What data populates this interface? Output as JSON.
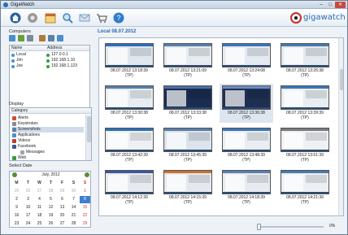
{
  "window": {
    "title": "GigaWatch",
    "min": "–",
    "max": "□",
    "close": "✕"
  },
  "toolbar": {
    "buttons": [
      {
        "icon": "home-icon",
        "color": "#2a5f9e"
      },
      {
        "icon": "gear-icon",
        "color": "#8e8e8e"
      },
      {
        "icon": "calendar-icon",
        "color": "#d8a23a"
      },
      {
        "icon": "search-icon",
        "color": "#3d86c9"
      },
      {
        "icon": "mail-icon",
        "color": "#9ab8d8"
      },
      {
        "icon": "cart-icon",
        "color": "#7a7a7a"
      },
      {
        "icon": "help-icon",
        "color": "#2f7ccc"
      }
    ],
    "logo_text": "gigawatch"
  },
  "sidebar": {
    "computers_label": "Computers",
    "computers_header": {
      "name": "Name",
      "address": "Address"
    },
    "computers": [
      {
        "name": "Local",
        "address": "127.0.0.1"
      },
      {
        "name": "Jim",
        "address": "192.168.1.10"
      },
      {
        "name": "Joe",
        "address": "192.168.1.123"
      }
    ],
    "display_label": "Display",
    "category_header": "Category",
    "categories": [
      {
        "label": "Alerts",
        "color": "#d04a3a",
        "indent": 0
      },
      {
        "label": "Keystrokes",
        "color": "#8a8a8a",
        "indent": 0
      },
      {
        "label": "Screenshots",
        "color": "#5c7fa8",
        "indent": 0
      },
      {
        "label": "Applications",
        "color": "#4a8ed0",
        "indent": 0
      },
      {
        "label": "Videos",
        "color": "#c0392b",
        "indent": 0
      },
      {
        "label": "Facebook",
        "color": "#3b5998",
        "indent": 0
      },
      {
        "label": "Messages",
        "color": "#9aa6b2",
        "indent": 1
      },
      {
        "label": "Web",
        "color": "#3a9a3a",
        "indent": 0
      }
    ],
    "select_date_label": "Select Date",
    "calendar": {
      "month_label": "July,   2012",
      "weekdays": [
        "M",
        "T",
        "W",
        "T",
        "F",
        "S",
        "S"
      ],
      "weeks": [
        [
          "25",
          "26",
          "27",
          "28",
          "29",
          "30",
          "1"
        ],
        [
          "2",
          "3",
          "4",
          "5",
          "6",
          "7",
          "8"
        ],
        [
          "9",
          "10",
          "11",
          "12",
          "13",
          "14",
          "15"
        ],
        [
          "16",
          "17",
          "18",
          "19",
          "20",
          "21",
          "22"
        ],
        [
          "23",
          "24",
          "25",
          "26",
          "27",
          "28",
          "29"
        ]
      ],
      "selected": "8"
    }
  },
  "main": {
    "title": "Local 08.07.2012",
    "captions": [
      "08.07.2012 13:18:39\n(TP)",
      "08.07.2012 13:21:09\n(TP)",
      "08.07.2012 13:24:08\n(TP)",
      "08.07.2012 13:26:38\n(TP)",
      "08.07.2012 13:30:38\n(TP)",
      "08.07.2012 13:33:38\n(TP)",
      "08.07.2012 13:36:38\n(TP)",
      "08.07.2012 13:39:39\n(TP)",
      "08.07.2012 13:42:39\n(TP)",
      "08.07.2012 13:45:39\n(TP)",
      "08.07.2012 13:48:39\n(TP)",
      "08.07.2012 13:51:39\n(TP)",
      "08.07.2012 14:12:39\n(TP)",
      "08.07.2012 14:15:39\n(TP)",
      "08.07.2012 14:18:39\n(TP)",
      "08.07.2012 14:21:39\n(TP)"
    ],
    "zoom_percent": "0%",
    "zoom_value": 0
  }
}
